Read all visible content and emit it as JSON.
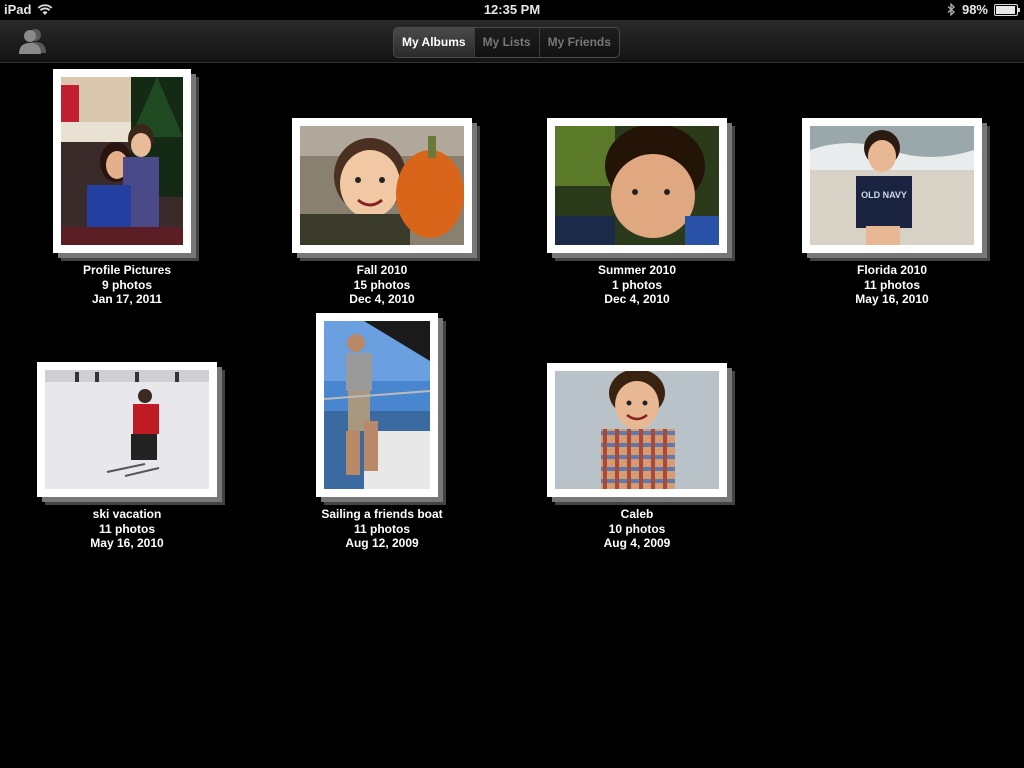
{
  "status": {
    "device": "iPad",
    "time": "12:35 PM",
    "battery": "98%",
    "battery_level": 0.98
  },
  "tabs": [
    "My Albums",
    "My Lists",
    "My Friends"
  ],
  "albums": [
    {
      "title": "Profile Pictures",
      "count": "9 photos",
      "date": "Jan 17, 2011"
    },
    {
      "title": "Fall 2010",
      "count": "15 photos",
      "date": "Dec 4, 2010"
    },
    {
      "title": "Summer 2010",
      "count": "1 photos",
      "date": "Dec 4, 2010"
    },
    {
      "title": "Florida 2010",
      "count": "11 photos",
      "date": "May 16, 2010"
    },
    {
      "title": "ski vacation",
      "count": "11 photos",
      "date": "May 16, 2010"
    },
    {
      "title": "Sailing a friends boat",
      "count": "11 photos",
      "date": "Aug 12, 2009"
    },
    {
      "title": "Caleb",
      "count": "10 photos",
      "date": "Aug 4, 2009"
    }
  ],
  "shirt_text": "OLD NAVY"
}
